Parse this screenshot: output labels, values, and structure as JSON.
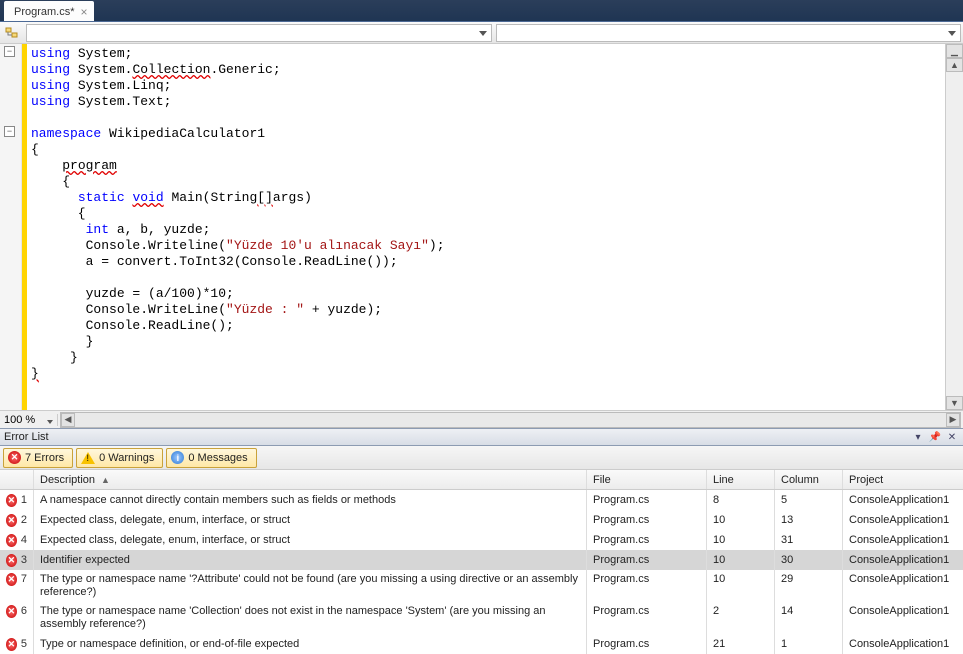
{
  "tab": {
    "title": "Program.cs*",
    "close": "×"
  },
  "zoom": "100 %",
  "code": {
    "l1_kw": "using",
    "l1_rest": " System;",
    "l2_kw": "using",
    "l2a": " System.",
    "l2_err": "Collection",
    "l2b": ".Generic;",
    "l3_kw": "using",
    "l3_rest": " System.Linq;",
    "l4_kw": "using",
    "l4_rest": " System.Text;",
    "l6_kw": "namespace",
    "l6_rest": " WikipediaCalculator1",
    "l7": "{",
    "l8a": "    ",
    "l8_err": "program",
    "l9": "    {",
    "l10a": "      ",
    "l10_kw1": "static",
    "l10_sp": " ",
    "l10_kw2": "void",
    "l10b": " Main(String",
    "l10_err": "[]",
    "l10c": "args)",
    "l11": "      {",
    "l12a": "       ",
    "l12_kw": "int",
    "l12b": " a, b, yuzde;",
    "l13a": "       Console.Writeline(",
    "l13_str": "\"Yüzde 10'u alınacak Sayı\"",
    "l13b": ");",
    "l14": "       a = convert.ToInt32(Console.ReadLine());",
    "l16": "       yuzde = (a/100)*10;",
    "l17a": "       Console.WriteLine(",
    "l17_str": "\"Yüzde : \"",
    "l17b": " + yuzde);",
    "l18": "       Console.ReadLine();",
    "l19": "       }",
    "l20": "     }",
    "l21_err": "}"
  },
  "errorListTitle": "Error List",
  "filters": {
    "errors": "7 Errors",
    "warnings": "0 Warnings",
    "messages": "0 Messages"
  },
  "cols": {
    "desc": "Description",
    "file": "File",
    "line": "Line",
    "column": "Column",
    "project": "Project"
  },
  "errors": [
    {
      "n": "1",
      "desc": "A namespace cannot directly contain members such as fields or methods",
      "file": "Program.cs",
      "line": "8",
      "col": "5",
      "proj": "ConsoleApplication1",
      "sel": false,
      "tall": false
    },
    {
      "n": "2",
      "desc": "Expected class, delegate, enum, interface, or struct",
      "file": "Program.cs",
      "line": "10",
      "col": "13",
      "proj": "ConsoleApplication1",
      "sel": false,
      "tall": false
    },
    {
      "n": "4",
      "desc": "Expected class, delegate, enum, interface, or struct",
      "file": "Program.cs",
      "line": "10",
      "col": "31",
      "proj": "ConsoleApplication1",
      "sel": false,
      "tall": false
    },
    {
      "n": "3",
      "desc": "Identifier expected",
      "file": "Program.cs",
      "line": "10",
      "col": "30",
      "proj": "ConsoleApplication1",
      "sel": true,
      "tall": false
    },
    {
      "n": "7",
      "desc": "The type or namespace name '?Attribute' could not be found (are you missing a using directive or an assembly reference?)",
      "file": "Program.cs",
      "line": "10",
      "col": "29",
      "proj": "ConsoleApplication1",
      "sel": false,
      "tall": true
    },
    {
      "n": "6",
      "desc": "The type or namespace name 'Collection' does not exist in the namespace 'System' (are you missing an assembly reference?)",
      "file": "Program.cs",
      "line": "2",
      "col": "14",
      "proj": "ConsoleApplication1",
      "sel": false,
      "tall": true
    },
    {
      "n": "5",
      "desc": "Type or namespace definition, or end-of-file expected",
      "file": "Program.cs",
      "line": "21",
      "col": "1",
      "proj": "ConsoleApplication1",
      "sel": false,
      "tall": false
    }
  ]
}
